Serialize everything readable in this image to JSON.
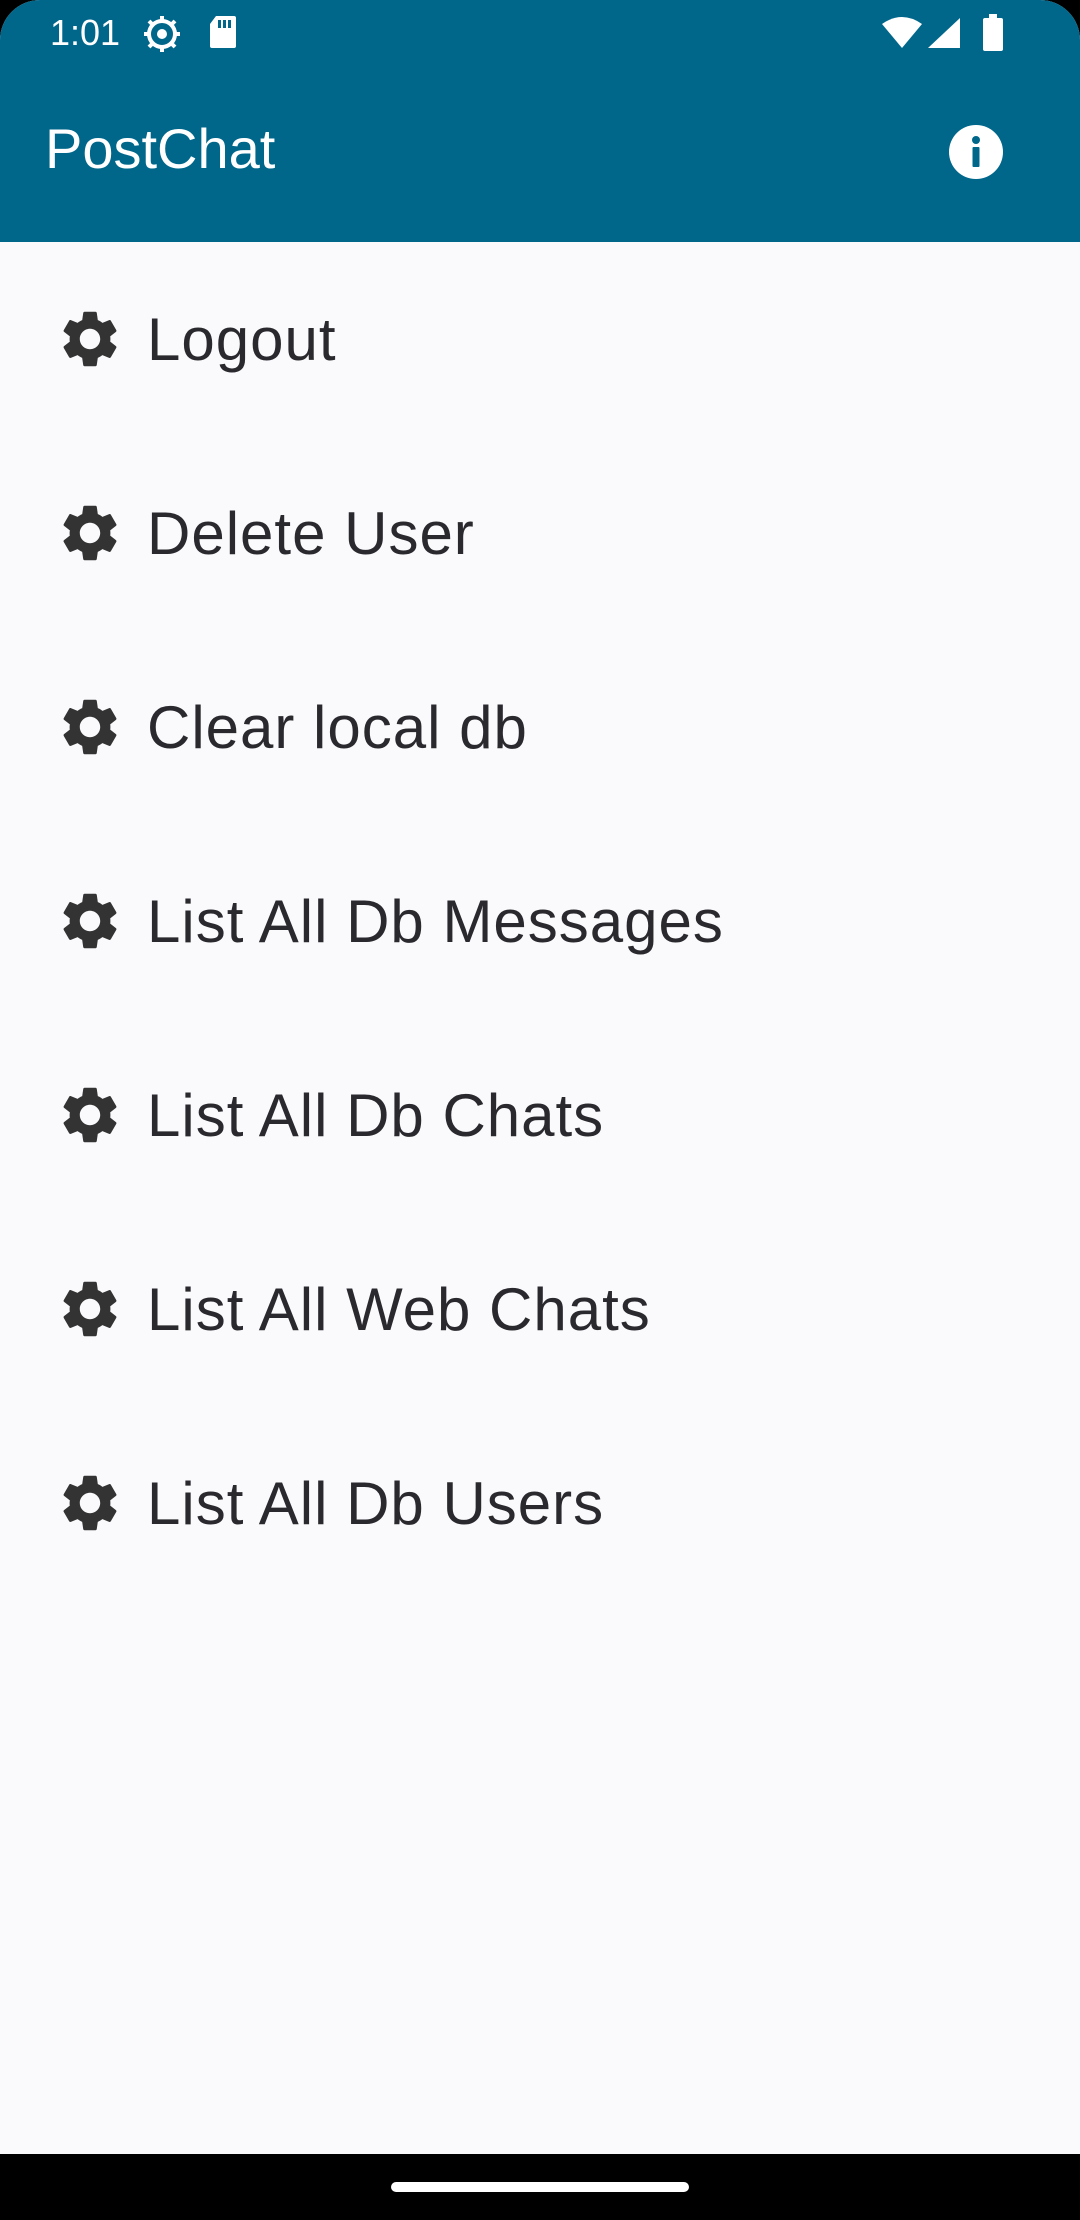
{
  "status_bar": {
    "time": "1:01",
    "icons": [
      "settings-gear-icon",
      "sd-card-icon",
      "wifi-icon",
      "cell-signal-icon",
      "battery-icon"
    ]
  },
  "app_bar": {
    "title": "PostChat",
    "info_icon": "info-icon",
    "background_color": "#00678B"
  },
  "menu": {
    "icon": "gear-icon",
    "items": [
      {
        "label": "Logout"
      },
      {
        "label": "Delete User"
      },
      {
        "label": "Clear local db"
      },
      {
        "label": "List All Db Messages"
      },
      {
        "label": "List All Db Chats"
      },
      {
        "label": "List All Web Chats"
      },
      {
        "label": "List All Db Users"
      }
    ]
  },
  "colors": {
    "primary": "#00678B",
    "background": "#FAFAFD",
    "text": "#2A2A2E"
  }
}
